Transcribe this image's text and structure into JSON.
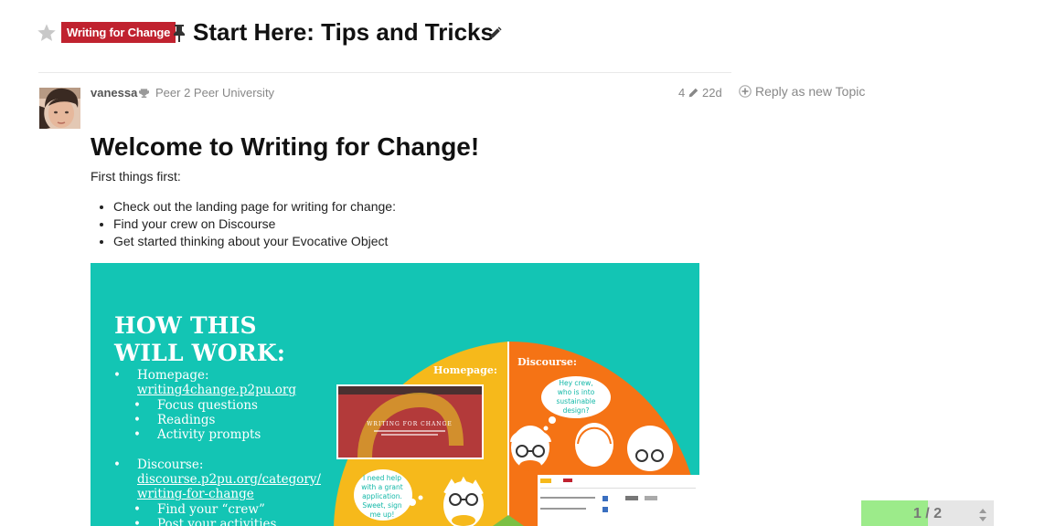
{
  "topic": {
    "category": "Writing for Change",
    "title": "Start Here: Tips and Tricks"
  },
  "post": {
    "username": "vanessa",
    "group": "Peer 2 Peer University",
    "edit_count": "4",
    "age": "22d",
    "heading": "Welcome to Writing for Change!",
    "intro": "First things first:",
    "bullets": [
      "Check out the landing page for writing for change:",
      "Find your crew on Discourse",
      "Get started thinking about your Evocative Object"
    ]
  },
  "actions": {
    "reply_label": "Reply as new Topic"
  },
  "infographic": {
    "heading_line1": "HOW THIS",
    "heading_line2": "WILL WORK:",
    "bullet": "•",
    "homepage_label": "Homepage:",
    "homepage_url": "writing4change.p2pu.org",
    "homepage_items": [
      "Focus questions",
      "Readings",
      "Activity prompts"
    ],
    "discourse_label": "Discourse:",
    "discourse_url_1": "discourse.p2pu.org/category/",
    "discourse_url_2": "writing-for-change",
    "discourse_items": [
      "Find your “crew”",
      "Post your activities"
    ],
    "pie_homepage": "Homepage:",
    "pie_discourse": "Discourse:",
    "thumb_title": "WRITING FOR CHANGE",
    "bubble_discourse": [
      "Hey crew,",
      "who is into",
      "sustainable",
      "design?"
    ],
    "bubble_homepage": [
      "I need help",
      "with a grant",
      "application.",
      "Sweet, sign",
      "me up!"
    ],
    "colors": {
      "teal": "#13c5b4",
      "yellow": "#f6b91b",
      "orange": "#f57315",
      "bubble_text": "#13b8a8"
    }
  },
  "timeline": {
    "current": 1,
    "total": 2,
    "label": "1 / 2",
    "progress": 0.5
  },
  "colors": {
    "category_badge": "#c0222f",
    "muted_text": "#888888",
    "progress_fill": "#9ceb8a"
  }
}
